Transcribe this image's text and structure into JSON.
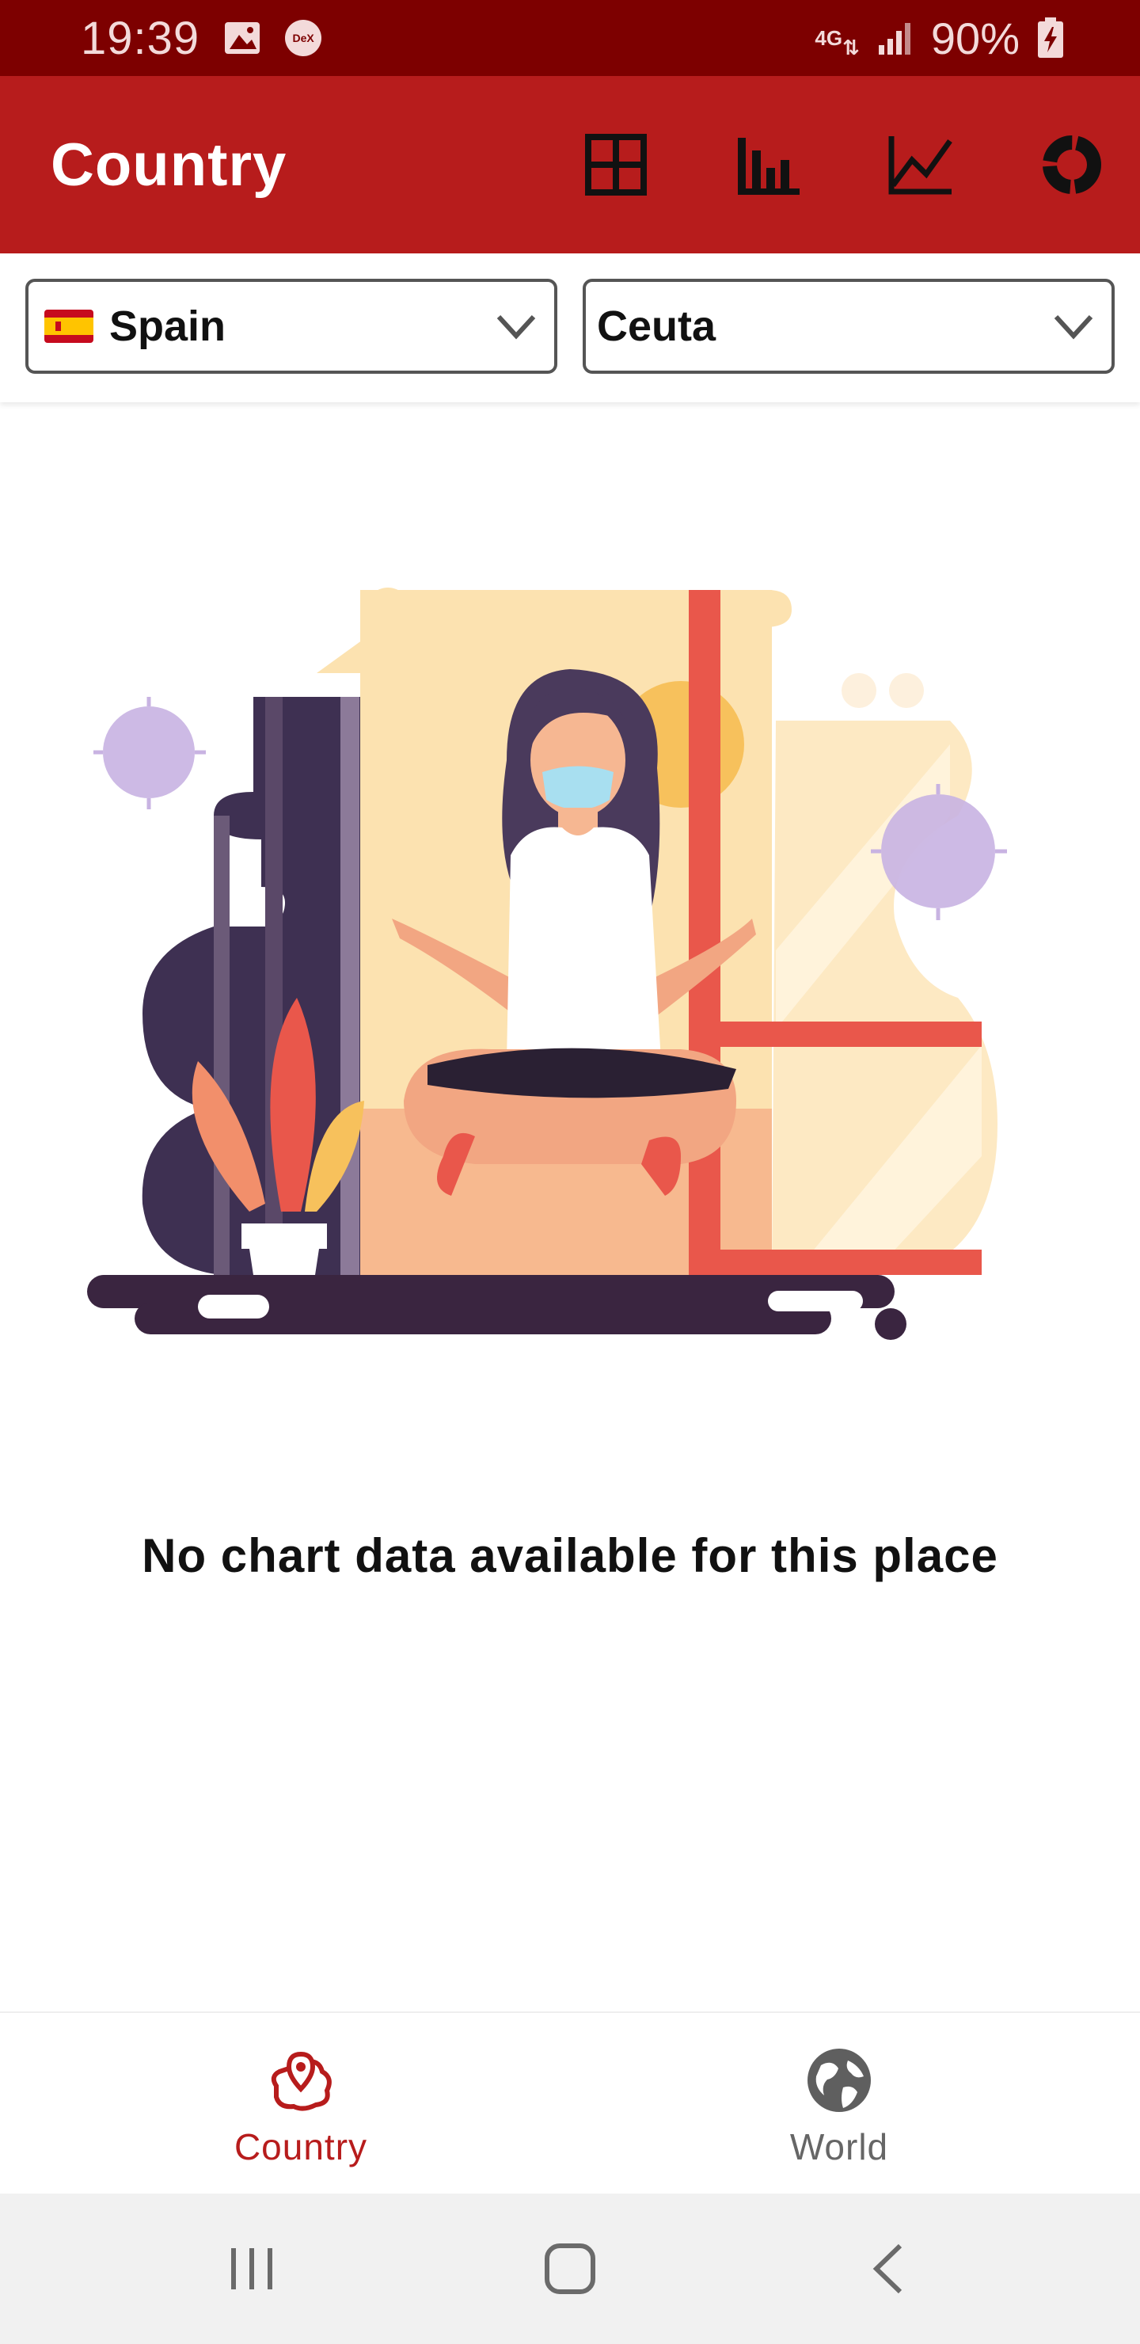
{
  "status_bar": {
    "time": "19:39",
    "network": "4G",
    "battery": "90%",
    "icons": [
      "image-icon",
      "dex-icon",
      "signal-icon",
      "battery-charging-icon"
    ]
  },
  "app_bar": {
    "title": "Country",
    "actions": [
      "table-icon",
      "bar-chart-icon",
      "line-chart-icon",
      "donut-chart-icon"
    ],
    "background": "#b71c1c"
  },
  "selectors": {
    "country": "Spain",
    "region": "Ceuta"
  },
  "empty_state": {
    "message": "No chart data available for this place"
  },
  "bottom_nav": {
    "items": [
      {
        "label": "Country",
        "icon": "map-pin-icon",
        "active": true
      },
      {
        "label": "World",
        "icon": "globe-icon",
        "active": false
      }
    ],
    "active_color": "#b71c1c",
    "inactive_color": "#666666"
  },
  "system_nav": [
    "recent-apps-icon",
    "home-icon",
    "back-icon"
  ]
}
